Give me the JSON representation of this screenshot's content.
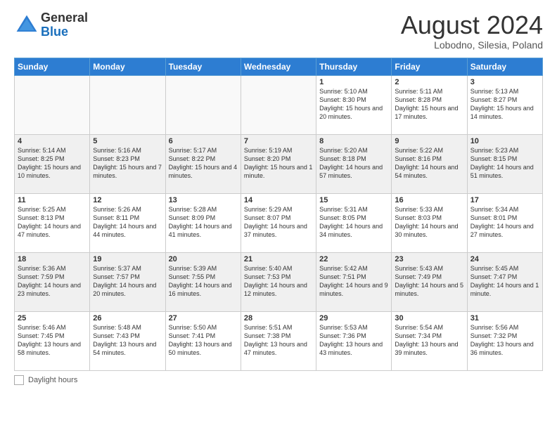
{
  "logo": {
    "general": "General",
    "blue": "Blue"
  },
  "title": "August 2024",
  "location": "Lobodno, Silesia, Poland",
  "weekdays": [
    "Sunday",
    "Monday",
    "Tuesday",
    "Wednesday",
    "Thursday",
    "Friday",
    "Saturday"
  ],
  "weeks": [
    [
      {
        "day": "",
        "info": ""
      },
      {
        "day": "",
        "info": ""
      },
      {
        "day": "",
        "info": ""
      },
      {
        "day": "",
        "info": ""
      },
      {
        "day": "1",
        "info": "Sunrise: 5:10 AM\nSunset: 8:30 PM\nDaylight: 15 hours and 20 minutes."
      },
      {
        "day": "2",
        "info": "Sunrise: 5:11 AM\nSunset: 8:28 PM\nDaylight: 15 hours and 17 minutes."
      },
      {
        "day": "3",
        "info": "Sunrise: 5:13 AM\nSunset: 8:27 PM\nDaylight: 15 hours and 14 minutes."
      }
    ],
    [
      {
        "day": "4",
        "info": "Sunrise: 5:14 AM\nSunset: 8:25 PM\nDaylight: 15 hours and 10 minutes."
      },
      {
        "day": "5",
        "info": "Sunrise: 5:16 AM\nSunset: 8:23 PM\nDaylight: 15 hours and 7 minutes."
      },
      {
        "day": "6",
        "info": "Sunrise: 5:17 AM\nSunset: 8:22 PM\nDaylight: 15 hours and 4 minutes."
      },
      {
        "day": "7",
        "info": "Sunrise: 5:19 AM\nSunset: 8:20 PM\nDaylight: 15 hours and 1 minute."
      },
      {
        "day": "8",
        "info": "Sunrise: 5:20 AM\nSunset: 8:18 PM\nDaylight: 14 hours and 57 minutes."
      },
      {
        "day": "9",
        "info": "Sunrise: 5:22 AM\nSunset: 8:16 PM\nDaylight: 14 hours and 54 minutes."
      },
      {
        "day": "10",
        "info": "Sunrise: 5:23 AM\nSunset: 8:15 PM\nDaylight: 14 hours and 51 minutes."
      }
    ],
    [
      {
        "day": "11",
        "info": "Sunrise: 5:25 AM\nSunset: 8:13 PM\nDaylight: 14 hours and 47 minutes."
      },
      {
        "day": "12",
        "info": "Sunrise: 5:26 AM\nSunset: 8:11 PM\nDaylight: 14 hours and 44 minutes."
      },
      {
        "day": "13",
        "info": "Sunrise: 5:28 AM\nSunset: 8:09 PM\nDaylight: 14 hours and 41 minutes."
      },
      {
        "day": "14",
        "info": "Sunrise: 5:29 AM\nSunset: 8:07 PM\nDaylight: 14 hours and 37 minutes."
      },
      {
        "day": "15",
        "info": "Sunrise: 5:31 AM\nSunset: 8:05 PM\nDaylight: 14 hours and 34 minutes."
      },
      {
        "day": "16",
        "info": "Sunrise: 5:33 AM\nSunset: 8:03 PM\nDaylight: 14 hours and 30 minutes."
      },
      {
        "day": "17",
        "info": "Sunrise: 5:34 AM\nSunset: 8:01 PM\nDaylight: 14 hours and 27 minutes."
      }
    ],
    [
      {
        "day": "18",
        "info": "Sunrise: 5:36 AM\nSunset: 7:59 PM\nDaylight: 14 hours and 23 minutes."
      },
      {
        "day": "19",
        "info": "Sunrise: 5:37 AM\nSunset: 7:57 PM\nDaylight: 14 hours and 20 minutes."
      },
      {
        "day": "20",
        "info": "Sunrise: 5:39 AM\nSunset: 7:55 PM\nDaylight: 14 hours and 16 minutes."
      },
      {
        "day": "21",
        "info": "Sunrise: 5:40 AM\nSunset: 7:53 PM\nDaylight: 14 hours and 12 minutes."
      },
      {
        "day": "22",
        "info": "Sunrise: 5:42 AM\nSunset: 7:51 PM\nDaylight: 14 hours and 9 minutes."
      },
      {
        "day": "23",
        "info": "Sunrise: 5:43 AM\nSunset: 7:49 PM\nDaylight: 14 hours and 5 minutes."
      },
      {
        "day": "24",
        "info": "Sunrise: 5:45 AM\nSunset: 7:47 PM\nDaylight: 14 hours and 1 minute."
      }
    ],
    [
      {
        "day": "25",
        "info": "Sunrise: 5:46 AM\nSunset: 7:45 PM\nDaylight: 13 hours and 58 minutes."
      },
      {
        "day": "26",
        "info": "Sunrise: 5:48 AM\nSunset: 7:43 PM\nDaylight: 13 hours and 54 minutes."
      },
      {
        "day": "27",
        "info": "Sunrise: 5:50 AM\nSunset: 7:41 PM\nDaylight: 13 hours and 50 minutes."
      },
      {
        "day": "28",
        "info": "Sunrise: 5:51 AM\nSunset: 7:38 PM\nDaylight: 13 hours and 47 minutes."
      },
      {
        "day": "29",
        "info": "Sunrise: 5:53 AM\nSunset: 7:36 PM\nDaylight: 13 hours and 43 minutes."
      },
      {
        "day": "30",
        "info": "Sunrise: 5:54 AM\nSunset: 7:34 PM\nDaylight: 13 hours and 39 minutes."
      },
      {
        "day": "31",
        "info": "Sunrise: 5:56 AM\nSunset: 7:32 PM\nDaylight: 13 hours and 36 minutes."
      }
    ]
  ],
  "footer": {
    "label": "Daylight hours"
  }
}
